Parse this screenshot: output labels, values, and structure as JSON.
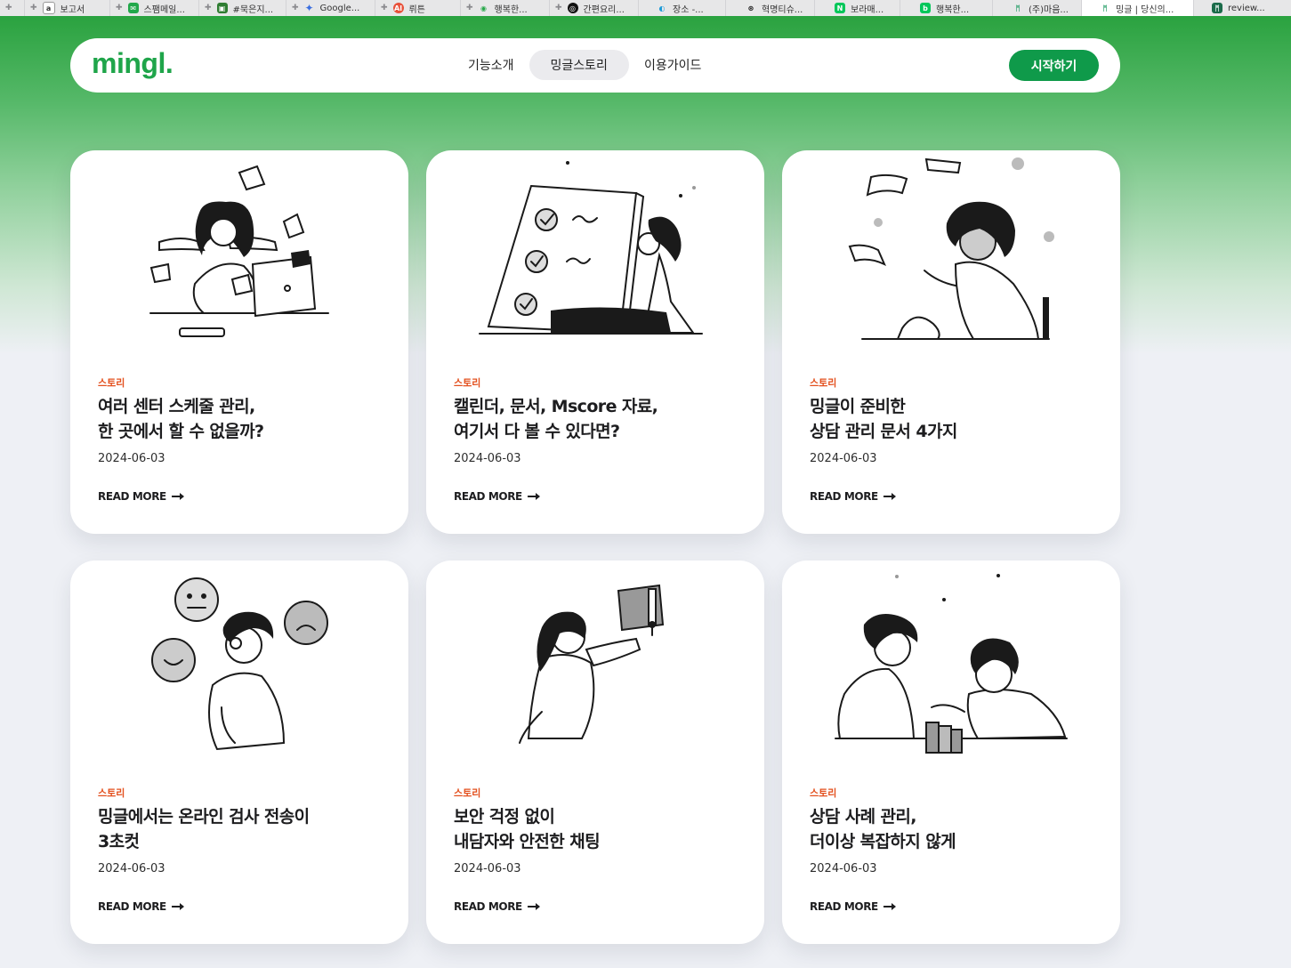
{
  "tabs": [
    {
      "label": "",
      "fav": "",
      "color": "#cccccc"
    },
    {
      "label": "보고서",
      "fav": "a",
      "color": "#ffffff"
    },
    {
      "label": "스팸메일...",
      "fav": "✉",
      "color": "#22a84b"
    },
    {
      "label": "#묵은지...",
      "fav": "▣",
      "color": "#2f7d32"
    },
    {
      "label": "Google...",
      "fav": "✦",
      "color": "#3b6fe0"
    },
    {
      "label": "뤼튼",
      "fav": "AI",
      "color": "#e8513a"
    },
    {
      "label": "행복한...",
      "fav": "◉",
      "color": "#27a84a"
    },
    {
      "label": "간편요리...",
      "fav": "◎",
      "color": "#111111"
    },
    {
      "label": "장소 -...",
      "fav": "◐",
      "color": "#1e9bd7"
    },
    {
      "label": "혁명티슈...",
      "fav": "⊛",
      "color": "#111111"
    },
    {
      "label": "보라매...",
      "fav": "N",
      "color": "#03c75a"
    },
    {
      "label": "행복한...",
      "fav": "b",
      "color": "#03c75a"
    },
    {
      "label": "(주)마음...",
      "fav": "ᛗ",
      "color": "#2aa06a"
    },
    {
      "label": "밍글 | 당신의...",
      "fav": "ᛗ",
      "color": "#2aa06a",
      "active": true
    },
    {
      "label": "review...",
      "fav": "ᛗ",
      "color": "#1b6b4a"
    }
  ],
  "nav": {
    "logo": "mingl.",
    "menu": [
      "기능소개",
      "밍글스토리",
      "이용가이드"
    ],
    "active_menu": "밍글스토리",
    "cta": "시작하기"
  },
  "cards": [
    {
      "tag": "스토리",
      "title": [
        "여러 센터 스케줄 관리,",
        "한 곳에서 할 수 없을까?"
      ],
      "date": "2024-06-03",
      "more": "READ MORE"
    },
    {
      "tag": "스토리",
      "title": [
        "캘린더, 문서, Mscore 자료,",
        "여기서 다 볼 수 있다면?"
      ],
      "date": "2024-06-03",
      "more": "READ MORE"
    },
    {
      "tag": "스토리",
      "title": [
        "밍글이 준비한",
        "상담 관리 문서 4가지"
      ],
      "date": "2024-06-03",
      "more": "READ MORE"
    },
    {
      "tag": "스토리",
      "title": [
        "밍글에서는 온라인 검사 전송이",
        "3초컷"
      ],
      "date": "2024-06-03",
      "more": "READ MORE"
    },
    {
      "tag": "스토리",
      "title": [
        "보안 걱정 없이",
        "내담자와 안전한 채팅"
      ],
      "date": "2024-06-03",
      "more": "READ MORE"
    },
    {
      "tag": "스토리",
      "title": [
        "상담 사례 관리,",
        "더이상 복잡하지 않게"
      ],
      "date": "2024-06-03",
      "more": "READ MORE"
    }
  ],
  "colors": {
    "brand": "#0f9a4a",
    "tag": "#e3501e"
  }
}
